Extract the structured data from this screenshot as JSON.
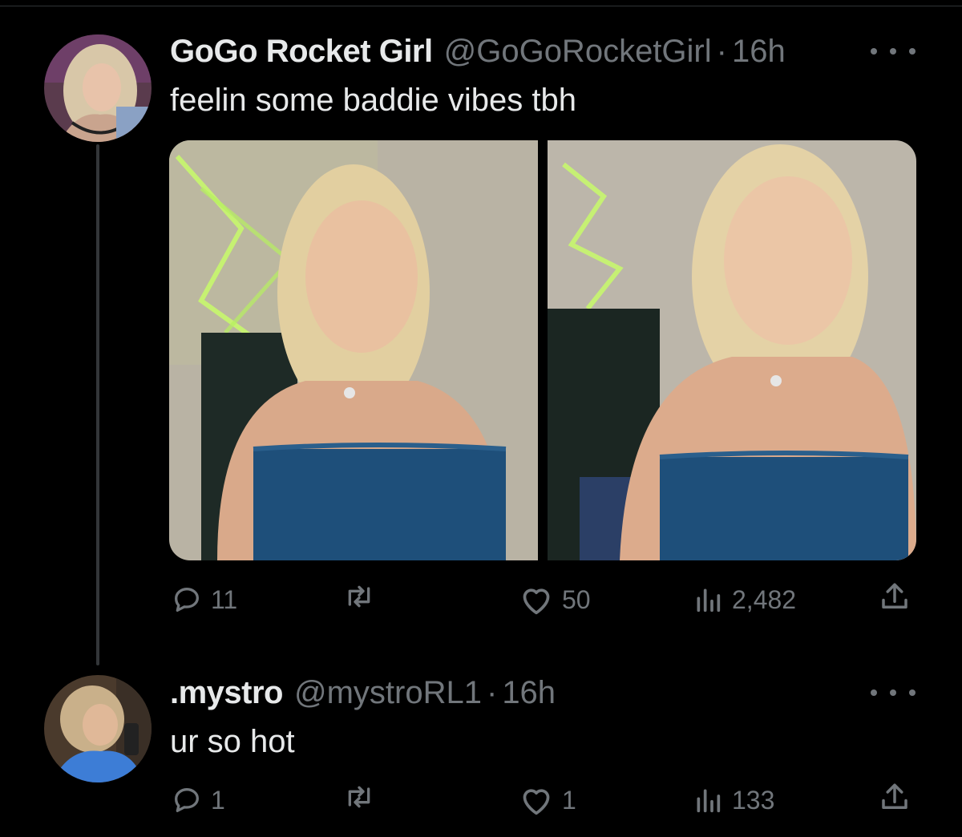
{
  "tweet": {
    "display_name": "GoGo Rocket Girl",
    "handle": "@GoGoRocketGirl",
    "separator": "·",
    "time": "16h",
    "text": "feelin some baddie vibes tbh",
    "avatar_icon": "user-avatar",
    "more_icon": "more-icon",
    "stats": {
      "replies": "11",
      "reposts": "",
      "likes": "50",
      "views": "2,482"
    },
    "photos": 2
  },
  "reply": {
    "display_name": ".mystro",
    "handle": "@mystroRL1",
    "separator": "·",
    "time": "16h",
    "text": "ur so hot",
    "avatar_icon": "user-avatar",
    "more_icon": "more-icon",
    "stats": {
      "replies": "1",
      "reposts": "",
      "likes": "1",
      "views": "133"
    }
  },
  "colors": {
    "background": "#000000",
    "primary_text": "#e7e9ea",
    "secondary_text": "#71767b",
    "thread_line": "#333639"
  }
}
